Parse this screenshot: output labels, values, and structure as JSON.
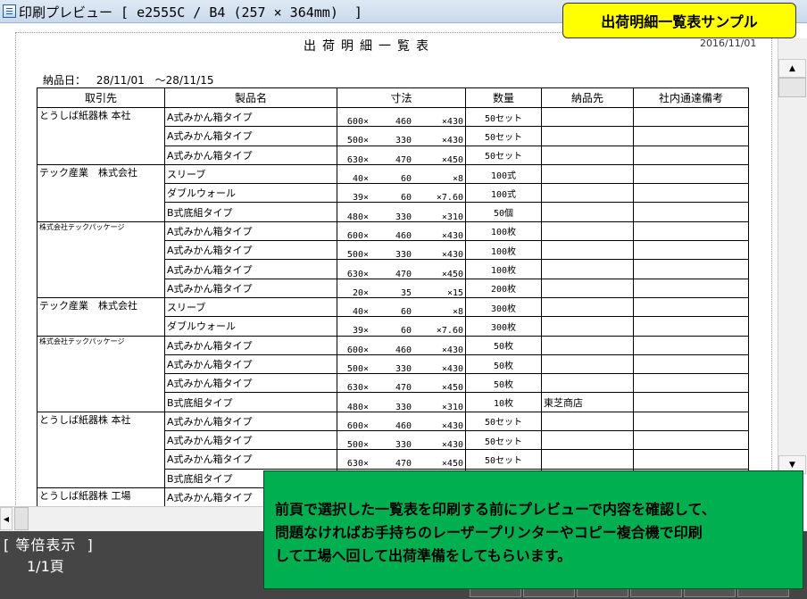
{
  "window": {
    "title": "印刷プレビュー [ e2555C / B4 (257 × 364mm)  ]"
  },
  "callout_title": "出荷明細一覧表サンプル",
  "document": {
    "title": "出荷明細一覧表",
    "date": "2016/11/01",
    "period_label": "納品日：",
    "period_from": "28/11/01",
    "period_to": "～28/11/15"
  },
  "table": {
    "headers": [
      "取引先",
      "製品名",
      "寸法",
      "数量",
      "納品先",
      "社内通達備考"
    ],
    "rows": [
      {
        "customer": "とうしば紙器株 本社",
        "product": "A式みかん箱タイプ",
        "d1": "600×",
        "d2": "460",
        "d3": "×430",
        "qty": "50セット",
        "dest": ""
      },
      {
        "customer": "",
        "product": "A式みかん箱タイプ",
        "d1": "500×",
        "d2": "330",
        "d3": "×430",
        "qty": "50セット",
        "dest": ""
      },
      {
        "customer": "",
        "product": "A式みかん箱タイプ",
        "d1": "630×",
        "d2": "470",
        "d3": "×450",
        "qty": "50セット",
        "dest": ""
      },
      {
        "customer": "テック産業　株式会社",
        "product": "スリーブ",
        "d1": "40×",
        "d2": "60",
        "d3": "×8",
        "qty": "100式",
        "dest": ""
      },
      {
        "customer": "",
        "product": "ダブルウォール",
        "d1": "39×",
        "d2": "60",
        "d3": "×7.60",
        "qty": "100式",
        "dest": ""
      },
      {
        "customer": "",
        "product": "B式底組タイプ",
        "d1": "480×",
        "d2": "330",
        "d3": "×310",
        "qty": "50個",
        "dest": ""
      },
      {
        "customer": "株式会社テックパッケージ",
        "product": "A式みかん箱タイプ",
        "d1": "600×",
        "d2": "460",
        "d3": "×430",
        "qty": "100枚",
        "dest": ""
      },
      {
        "customer": "",
        "product": "A式みかん箱タイプ",
        "d1": "500×",
        "d2": "330",
        "d3": "×430",
        "qty": "100枚",
        "dest": ""
      },
      {
        "customer": "",
        "product": "A式みかん箱タイプ",
        "d1": "630×",
        "d2": "470",
        "d3": "×450",
        "qty": "100枚",
        "dest": ""
      },
      {
        "customer": "",
        "product": "A式みかん箱タイプ",
        "d1": "20×",
        "d2": "35",
        "d3": "×15",
        "qty": "200枚",
        "dest": ""
      },
      {
        "customer": "テック産業　株式会社",
        "product": "スリーブ",
        "d1": "40×",
        "d2": "60",
        "d3": "×8",
        "qty": "300枚",
        "dest": ""
      },
      {
        "customer": "",
        "product": "ダブルウォール",
        "d1": "39×",
        "d2": "60",
        "d3": "×7.60",
        "qty": "300枚",
        "dest": ""
      },
      {
        "customer": "株式会社テックパッケージ",
        "product": "A式みかん箱タイプ",
        "d1": "600×",
        "d2": "460",
        "d3": "×430",
        "qty": "50枚",
        "dest": ""
      },
      {
        "customer": "",
        "product": "A式みかん箱タイプ",
        "d1": "500×",
        "d2": "330",
        "d3": "×430",
        "qty": "50枚",
        "dest": ""
      },
      {
        "customer": "",
        "product": "A式みかん箱タイプ",
        "d1": "630×",
        "d2": "470",
        "d3": "×450",
        "qty": "50枚",
        "dest": ""
      },
      {
        "customer": "",
        "product": "B式底組タイプ",
        "d1": "480×",
        "d2": "330",
        "d3": "×310",
        "qty": "10枚",
        "dest": "東芝商店"
      },
      {
        "customer": "とうしば紙器株 本社",
        "product": "A式みかん箱タイプ",
        "d1": "600×",
        "d2": "460",
        "d3": "×430",
        "qty": "50セット",
        "dest": ""
      },
      {
        "customer": "",
        "product": "A式みかん箱タイプ",
        "d1": "500×",
        "d2": "330",
        "d3": "×430",
        "qty": "50セット",
        "dest": ""
      },
      {
        "customer": "",
        "product": "A式みかん箱タイプ",
        "d1": "630×",
        "d2": "470",
        "d3": "×450",
        "qty": "50セット",
        "dest": ""
      },
      {
        "customer": "",
        "product": "B式底組タイプ",
        "d1": "",
        "d2": "",
        "d3": "",
        "qty": "",
        "dest": ""
      },
      {
        "customer": "とうしば紙器株 工場",
        "product": "A式みかん箱タイプ",
        "d1": "",
        "d2": "",
        "d3": "",
        "qty": "",
        "dest": ""
      }
    ]
  },
  "status": {
    "mode": "[ 等倍表示  ]",
    "page": "1/1頁"
  },
  "callout_note": {
    "lines": [
      "前頁で選択した一覧表を印刷する前にプレビューで内容を確認して、",
      "問題なければお手持ちのレーザープリンターやコピー複合機で印刷",
      "して工場へ回して出荷準備をしてもらいます。"
    ]
  },
  "colors": {
    "callout_title_bg": "#ffff00",
    "callout_note_bg": "#00b050",
    "status_bg": "#454545"
  }
}
